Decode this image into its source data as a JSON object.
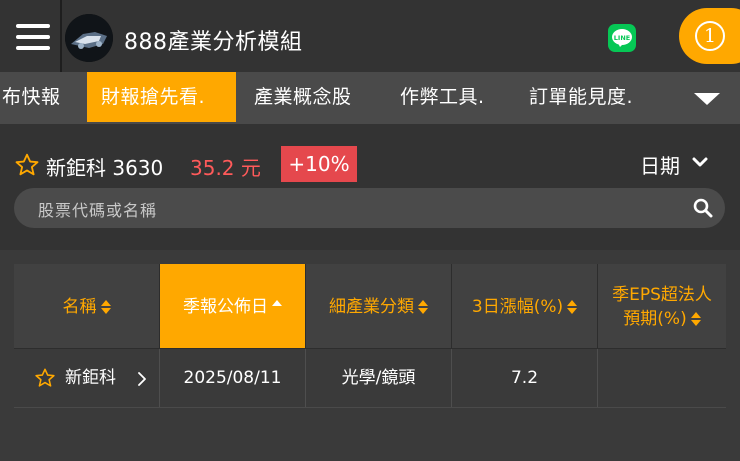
{
  "app": {
    "title": "888產業分析模組",
    "notification_count": "1"
  },
  "tabs": [
    {
      "label": "布快報"
    },
    {
      "label": "財報搶先看."
    },
    {
      "label": "產業概念股"
    },
    {
      "label": "作弊工具."
    },
    {
      "label": "訂單能見度."
    }
  ],
  "stock": {
    "name_code": "新鉅科 3630",
    "price": "35.2 元",
    "change": "+10%",
    "date_selector": "日期"
  },
  "search": {
    "placeholder": "股票代碼或名稱"
  },
  "table": {
    "headers": [
      "名稱",
      "季報公佈日",
      "細產業分類",
      "3日漲幅(%)",
      "季EPS超法人",
      "預期(%)"
    ],
    "rows": [
      {
        "name": "新鉅科",
        "date": "2025/08/11",
        "category": "光學/鏡頭",
        "change3d": "7.2",
        "eps": ""
      }
    ]
  },
  "colors": {
    "accent": "#ffa800",
    "price_red": "#ff5a5a",
    "change_badge": "#e5484d",
    "line_green": "#06c755",
    "background": "#3a3a3a"
  },
  "icons": {
    "menu": "hamburger-menu-icon",
    "line": "line-app-icon",
    "star": "star-outline-icon",
    "search": "search-icon",
    "dropdown": "chevron-down-icon"
  }
}
